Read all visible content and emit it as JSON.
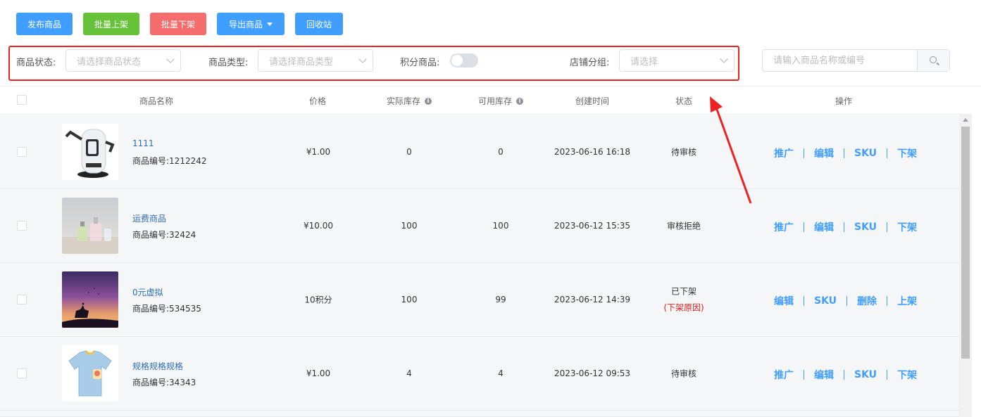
{
  "toolbar": {
    "publish": "发布商品",
    "batch_on": "批量上架",
    "batch_off": "批量下架",
    "export": "导出商品",
    "recycle": "回收站"
  },
  "filter": {
    "status_label": "商品状态:",
    "status_placeholder": "请选择商品状态",
    "type_label": "商品类型:",
    "type_placeholder": "请选择商品类型",
    "points_label": "积分商品:",
    "points_enabled": false,
    "store_label": "店铺分组:",
    "store_placeholder": "请选择",
    "search_placeholder": "请输入商品名称或编号"
  },
  "table": {
    "headers": {
      "name": "商品名称",
      "price": "价格",
      "actual_stock": "实际库存",
      "available_stock": "可用库存",
      "created": "创建时间",
      "status": "状态",
      "actions": "操作"
    },
    "rows": [
      {
        "name": "1111",
        "code": "商品编号:1212242",
        "price": "¥1.00",
        "actual_stock": "0",
        "available_stock": "0",
        "created": "2023-06-16 16:18",
        "status": "待审核",
        "reason": "",
        "image": "robot-product-image",
        "actions": [
          "推广",
          "编辑",
          "SKU",
          "下架"
        ]
      },
      {
        "name": "运费商品",
        "code": "商品编号:32424",
        "price": "¥10.00",
        "actual_stock": "100",
        "available_stock": "100",
        "created": "2023-06-12 15:35",
        "status": "审核拒绝",
        "reason": "",
        "image": "perfume-product-image",
        "actions": [
          "推广",
          "编辑",
          "SKU",
          "下架"
        ]
      },
      {
        "name": "0元虚拟",
        "code": "商品编号:534535",
        "price": "10积分",
        "actual_stock": "100",
        "available_stock": "99",
        "created": "2023-06-12 14:39",
        "status": "已下架",
        "reason": "(下架原因)",
        "image": "sunset-deer-image",
        "actions": [
          "编辑",
          "SKU",
          "删除",
          "上架"
        ]
      },
      {
        "name": "规格规格规格",
        "code": "商品编号:34343",
        "price": "¥1.00",
        "actual_stock": "4",
        "available_stock": "4",
        "created": "2023-06-12 09:53",
        "status": "待审核",
        "reason": "",
        "image": "tshirt-product-image",
        "actions": [
          "推广",
          "编辑",
          "SKU",
          "下架"
        ]
      }
    ]
  },
  "colors": {
    "primary": "#409eff",
    "success": "#67c23a",
    "danger": "#f56c6c",
    "annotation": "#ee2222"
  }
}
